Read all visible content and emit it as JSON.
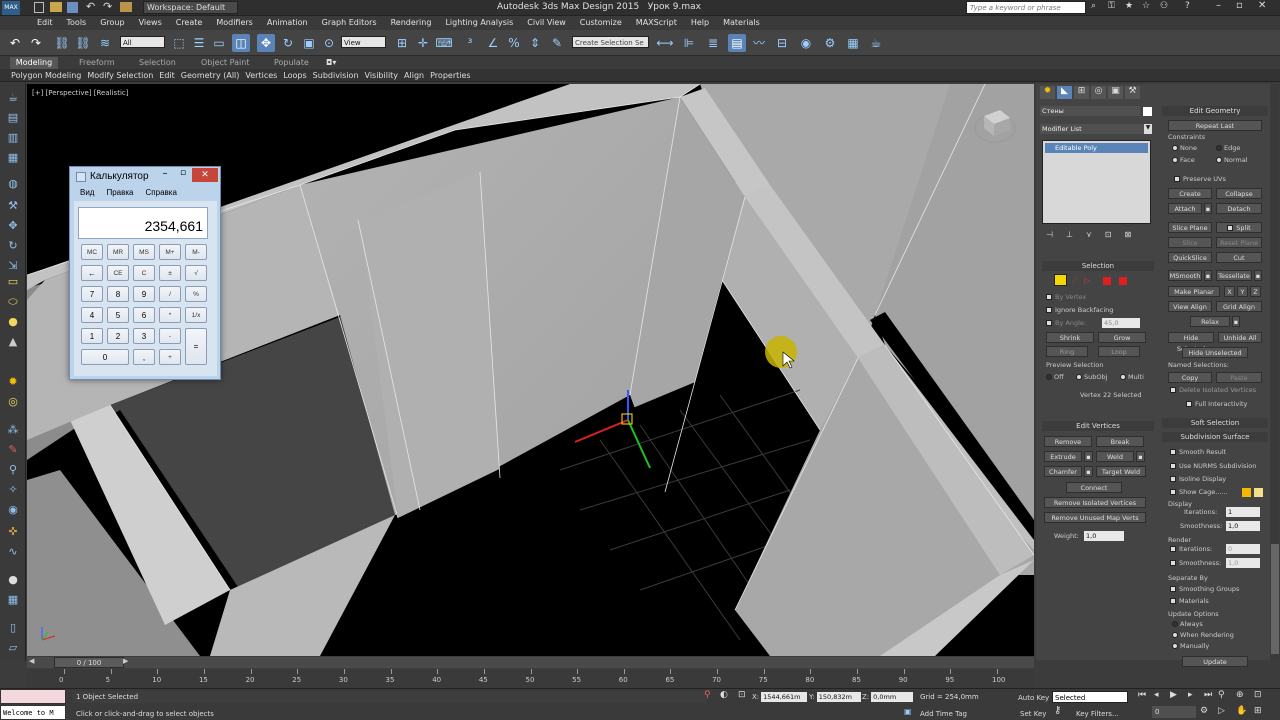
{
  "titlebar": {
    "workspace": "Workspace: Default",
    "app_title": "Autodesk 3ds Max Design 2015",
    "file_name": "Урок 9.max",
    "search_placeholder": "Type a keyword or phrase"
  },
  "menu": [
    "Edit",
    "Tools",
    "Group",
    "Views",
    "Create",
    "Modifiers",
    "Animation",
    "Graph Editors",
    "Rendering",
    "Lighting Analysis",
    "Civil View",
    "Customize",
    "MAXScript",
    "Help",
    "Materials"
  ],
  "toolbar": {
    "selection_filter": "All",
    "ref_coord": "View",
    "named_selection": "Create Selection Se"
  },
  "ribbon_tabs": [
    "Modeling",
    "Freeform",
    "Selection",
    "Object Paint",
    "Populate"
  ],
  "ribbon_panels": [
    "Polygon Modeling",
    "Modify Selection",
    "Edit",
    "Geometry (All)",
    "Vertices",
    "Loops",
    "Subdivision",
    "Visibility",
    "Align",
    "Properties"
  ],
  "viewport": {
    "label": "[+] [Perspective] [Realistic]"
  },
  "calculator": {
    "title": "Калькулятор",
    "menu": [
      "Вид",
      "Правка",
      "Справка"
    ],
    "display": "2354,661",
    "keys": [
      [
        "MC",
        "MR",
        "MS",
        "M+",
        "M-"
      ],
      [
        "←",
        "CE",
        "C",
        "±",
        "√"
      ],
      [
        "7",
        "8",
        "9",
        "/",
        "%"
      ],
      [
        "4",
        "5",
        "6",
        "*",
        "1/x"
      ],
      [
        "1",
        "2",
        "3",
        "-",
        "="
      ],
      [
        "0",
        ",",
        "+"
      ]
    ]
  },
  "modify_panel": {
    "object_name": "Стены",
    "modifier_list": "Modifier List",
    "stack_item": "Editable Poly",
    "selection": {
      "title": "Selection",
      "by_vertex": "By Vertex",
      "ignore_backfacing": "Ignore Backfacing",
      "by_angle": "By Angle:",
      "by_angle_value": "45,0",
      "shrink": "Shrink",
      "grow": "Grow",
      "ring": "Ring",
      "loop": "Loop",
      "preview_selection": "Preview Selection",
      "off": "Off",
      "subobj": "SubObj",
      "multi": "Multi",
      "status": "Vertex 22 Selected"
    },
    "edit_vertices": {
      "title": "Edit Vertices",
      "remove": "Remove",
      "break": "Break",
      "extrude": "Extrude",
      "weld": "Weld",
      "chamfer": "Chamfer",
      "target_weld": "Target Weld",
      "connect": "Connect",
      "remove_isolated": "Remove Isolated Vertices",
      "remove_unused": "Remove Unused Map Verts",
      "weight_label": "Weight:",
      "weight_value": "1,0"
    },
    "edit_geometry": {
      "title": "Edit Geometry",
      "repeat_last": "Repeat Last",
      "constraints": "Constraints",
      "none": "None",
      "edge": "Edge",
      "face": "Face",
      "normal": "Normal",
      "preserve_uvs": "Preserve UVs",
      "create": "Create",
      "collapse": "Collapse",
      "attach": "Attach",
      "detach": "Detach",
      "slice_plane": "Slice Plane",
      "split": "Split",
      "slice": "Slice",
      "reset_plane": "Reset Plane",
      "quickslice": "QuickSlice",
      "cut": "Cut",
      "msmooth": "MSmooth",
      "tessellate": "Tessellate",
      "make_planar": "Make Planar",
      "x": "X",
      "y": "Y",
      "z": "Z",
      "view_align": "View Align",
      "grid_align": "Grid Align",
      "relax": "Relax",
      "hide_selected": "Hide Selected",
      "unhide_all": "Unhide All",
      "hide_unselected": "Hide Unselected",
      "named_selections": "Named Selections:",
      "copy": "Copy",
      "paste": "Paste",
      "delete_isolated": "Delete Isolated Vertices",
      "full_interactivity": "Full Interactivity"
    },
    "soft_selection": "Soft Selection",
    "subdivision_surface": {
      "title": "Subdivision Surface",
      "smooth_result": "Smooth Result",
      "use_nurms": "Use NURMS Subdivision",
      "isoline_display": "Isoline Display",
      "show_cage": "Show Cage......",
      "display": "Display",
      "iterations": "Iterations:",
      "iterations_value": "1",
      "smoothness": "Smoothness:",
      "smoothness_value": "1,0",
      "render": "Render",
      "render_iterations_value": "0",
      "render_smoothness_value": "1,0",
      "separate_by": "Separate By",
      "smoothing_groups": "Smoothing Groups",
      "materials": "Materials",
      "update_options": "Update Options",
      "always": "Always",
      "when_rendering": "When Rendering",
      "manually": "Manually",
      "update": "Update"
    }
  },
  "timeline": {
    "frame_counter": "0 / 100",
    "ticks": [
      "0",
      "5",
      "10",
      "15",
      "20",
      "25",
      "30",
      "35",
      "40",
      "45",
      "50",
      "55",
      "60",
      "65",
      "70",
      "75",
      "80",
      "85",
      "90",
      "95",
      "100"
    ]
  },
  "status": {
    "maxscript": "Welcome to M",
    "selected": "1 Object Selected",
    "prompt": "Click or click-and-drag to select objects",
    "x_label": "X:",
    "x": "1544,661m",
    "y_label": "Y:",
    "y": "150,832m",
    "z_label": "Z:",
    "z": "0,0mm",
    "grid": "Grid = 254,0mm",
    "add_time_tag": "Add Time Tag",
    "auto_key": "Auto Key",
    "set_key": "Set Key",
    "key_mode": "Selected",
    "key_filters": "Key Filters...",
    "frame": "0"
  },
  "colors": {
    "accent": "#5a84b8",
    "cage_orange": "#f5b800",
    "cage_yellow": "#f3e08a",
    "cursor_highlight": "#c8b400"
  }
}
